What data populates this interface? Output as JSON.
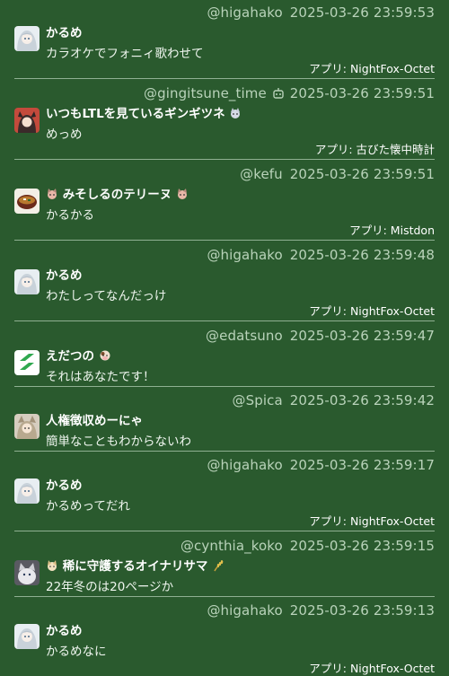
{
  "colors": {
    "background": "#2a5a2e",
    "meta": "#b9d3ba",
    "divider": "#8fb092"
  },
  "posts": [
    {
      "handle": "@higahako",
      "time": "2025-03-26 23:59:53",
      "name": "かるめ",
      "body": "カラオケでフォニィ歌わせて",
      "app": "アプリ: NightFox-Octet",
      "avatar": "anime-girl-avatar"
    },
    {
      "handle": "@gingitsune_time",
      "time": "2025-03-26 23:59:51",
      "name": "いつもLTLを見ているギンギツネ",
      "body": "めっめ",
      "app": "アプリ: 古びた懐中時計",
      "avatar": "fox-girl-avatar",
      "bot": true
    },
    {
      "handle": "@kefu",
      "time": "2025-03-26 23:59:51",
      "name": "みそしるのテリーヌ",
      "body": "かるかる",
      "app": "アプリ: Mistdon",
      "avatar": "miso-soup-avatar"
    },
    {
      "handle": "@higahako",
      "time": "2025-03-26 23:59:48",
      "name": "かるめ",
      "body": "わたしってなんだっけ",
      "app": "アプリ: NightFox-Octet",
      "avatar": "anime-girl-avatar"
    },
    {
      "handle": "@edatsuno",
      "time": "2025-03-26 23:59:47",
      "name": "えだつの",
      "body": "それはあなたです！",
      "app": "",
      "avatar": "green-logo-avatar"
    },
    {
      "handle": "@Spica",
      "time": "2025-03-26 23:59:42",
      "name": "人権徴収めーにゃ",
      "body": "簡単なこともわからないわ",
      "app": "",
      "avatar": "cat-girl-avatar"
    },
    {
      "handle": "@higahako",
      "time": "2025-03-26 23:59:17",
      "name": "かるめ",
      "body": "かるめってだれ",
      "app": "アプリ: NightFox-Octet",
      "avatar": "anime-girl-avatar"
    },
    {
      "handle": "@cynthia_koko",
      "time": "2025-03-26 23:59:15",
      "name": "稀に守護するオイナリサマ",
      "body": "22年冬のは20ページか",
      "app": "",
      "avatar": "cat-photo-avatar"
    },
    {
      "handle": "@higahako",
      "time": "2025-03-26 23:59:13",
      "name": "かるめ",
      "body": "かるめなに",
      "app": "アプリ: NightFox-Octet",
      "avatar": "anime-girl-avatar"
    }
  ]
}
